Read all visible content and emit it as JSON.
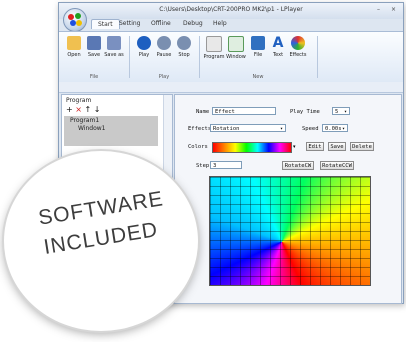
{
  "window": {
    "title": "C:\\Users\\Desktop\\CRT-200PRO MK2\\p1 - LPlayer",
    "minimize": "–",
    "close": "×"
  },
  "tabs": [
    "Start",
    "Setting",
    "Offline",
    "Debug",
    "Help"
  ],
  "ribbon": {
    "file_buttons": [
      "Open",
      "Save",
      "Save as"
    ],
    "play_buttons": [
      "Play",
      "Pause",
      "Stop"
    ],
    "new_buttons": [
      "Program",
      "Window",
      "File",
      "Text",
      "Effects"
    ],
    "groups": [
      "File",
      "Play",
      "New"
    ]
  },
  "left": {
    "title": "Program",
    "tools": [
      "+",
      "×",
      "↑",
      "↓"
    ],
    "tree": [
      "Program1",
      "Window1"
    ]
  },
  "form": {
    "name_label": "Name",
    "name_value": "Effect",
    "playtime_label": "Play Time",
    "playtime_value": "5",
    "effects_label": "Effects",
    "effects_value": "Rotation",
    "speed_label": "Speed",
    "speed_value": "0.00s",
    "colors_label": "Colors",
    "edit": "Edit",
    "save": "Save",
    "delete": "Delete",
    "step_label": "Step",
    "step_value": "3",
    "rotate_cw": "RotateCW",
    "rotate_ccw": "RotateCCW"
  },
  "badge": {
    "line1": "SOFTWARE",
    "line2": "INCLUDED"
  }
}
